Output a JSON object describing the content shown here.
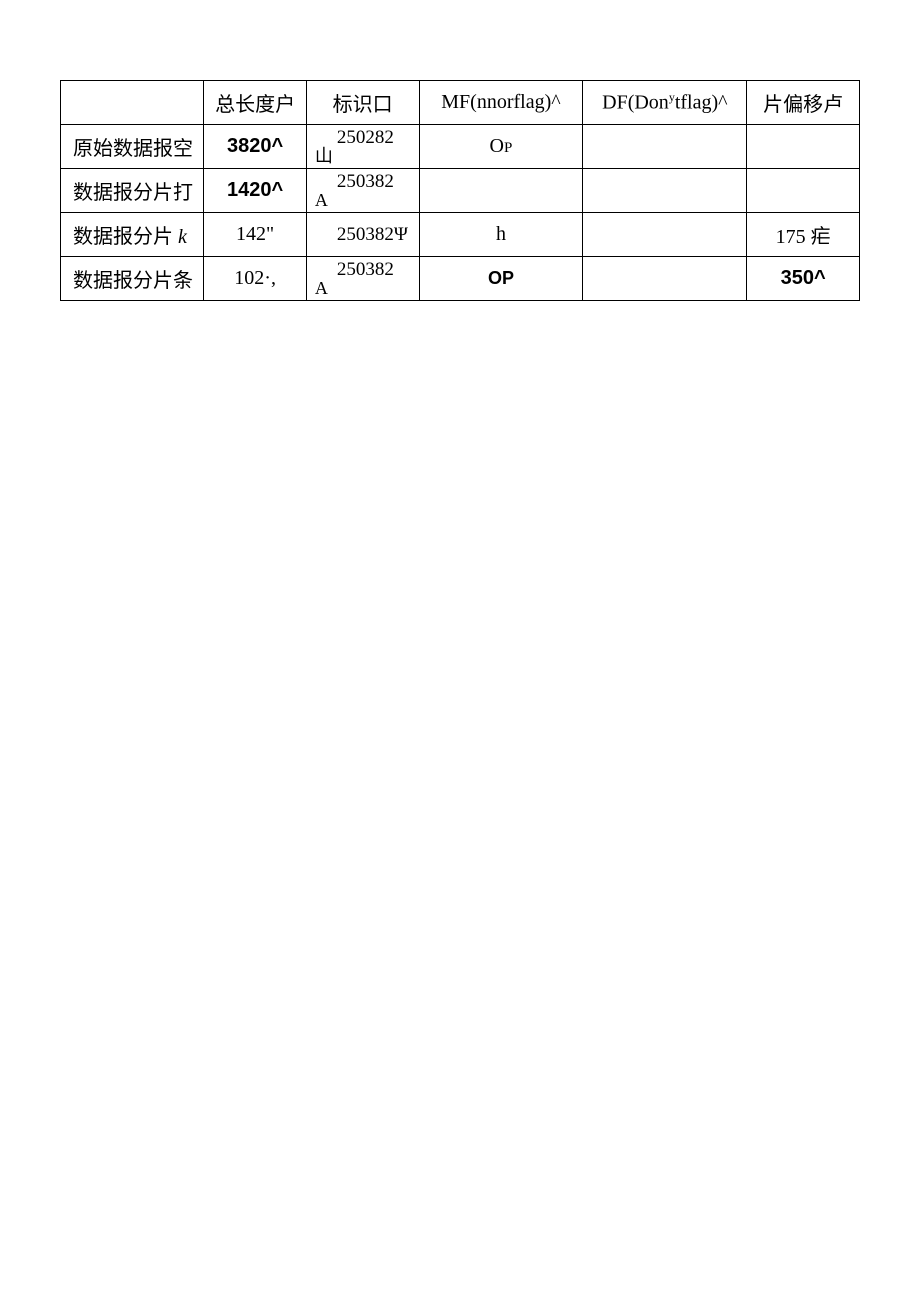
{
  "chart_data": {
    "type": "table",
    "headers": [
      "",
      "总长度户",
      "标识口",
      "MF(nnorflag)^",
      "DF(Donytflag)^",
      "片偏移卢"
    ],
    "rows": [
      {
        "label": "原始数据报空",
        "len": "3820^",
        "id_top": "250282",
        "id_bot": "山",
        "mf": "Oᴘ",
        "df": "",
        "offset": ""
      },
      {
        "label": "数据报分片打",
        "len": "1420^",
        "id_top": "250382",
        "id_bot": "A",
        "mf": "",
        "df": "",
        "offset": ""
      },
      {
        "label_pre": "数据报分片 ",
        "italic": "k",
        "len": "142\"",
        "id_top": "",
        "id_bot": "250382Ψ",
        "mf": "h",
        "df": "",
        "offset": "175 疟"
      },
      {
        "label": "数据报分片条",
        "len": "102·,",
        "id_top": "250382",
        "id_bot": "A",
        "mf": "OP",
        "df": "",
        "offset": "350^"
      }
    ]
  }
}
